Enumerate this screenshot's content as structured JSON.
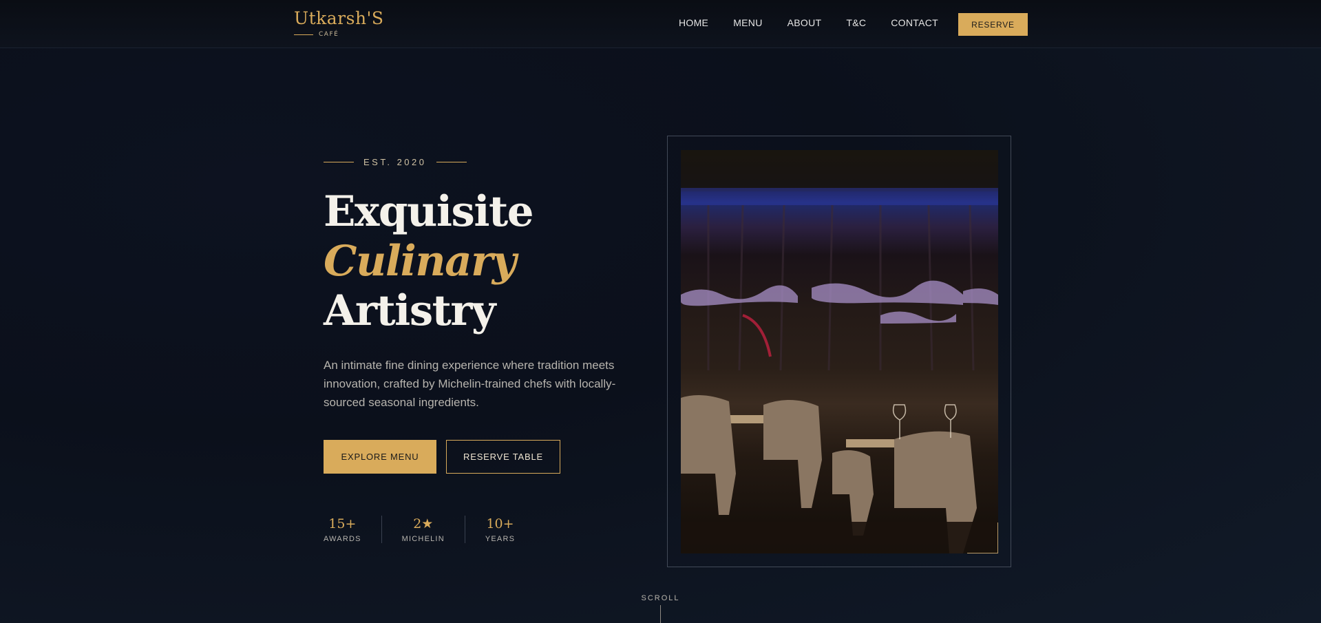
{
  "brand": {
    "name": "Utkarsh'S",
    "sub": "CAFÉ"
  },
  "nav": {
    "links": [
      "HOME",
      "MENU",
      "ABOUT",
      "T&C",
      "CONTACT"
    ],
    "cta": "RESERVE"
  },
  "hero": {
    "est": "EST. 2020",
    "title_line1": "Exquisite",
    "title_line2": "Culinary",
    "title_line3": "Artistry",
    "description": "An intimate fine dining experience where tradition meets innovation, crafted by Michelin-trained chefs with locally-sourced seasonal ingredients.",
    "primary_button": "EXPLORE MENU",
    "secondary_button": "RESERVE TABLE",
    "stats": [
      {
        "value": "15+",
        "label": "AWARDS"
      },
      {
        "value": "2★",
        "label": "MICHELIN"
      },
      {
        "value": "10+",
        "label": "YEARS"
      }
    ]
  },
  "scroll": {
    "label": "SCROLL"
  },
  "colors": {
    "accent": "#d9ab5b",
    "background": "#0b101b",
    "text": "#f4f1ea"
  }
}
